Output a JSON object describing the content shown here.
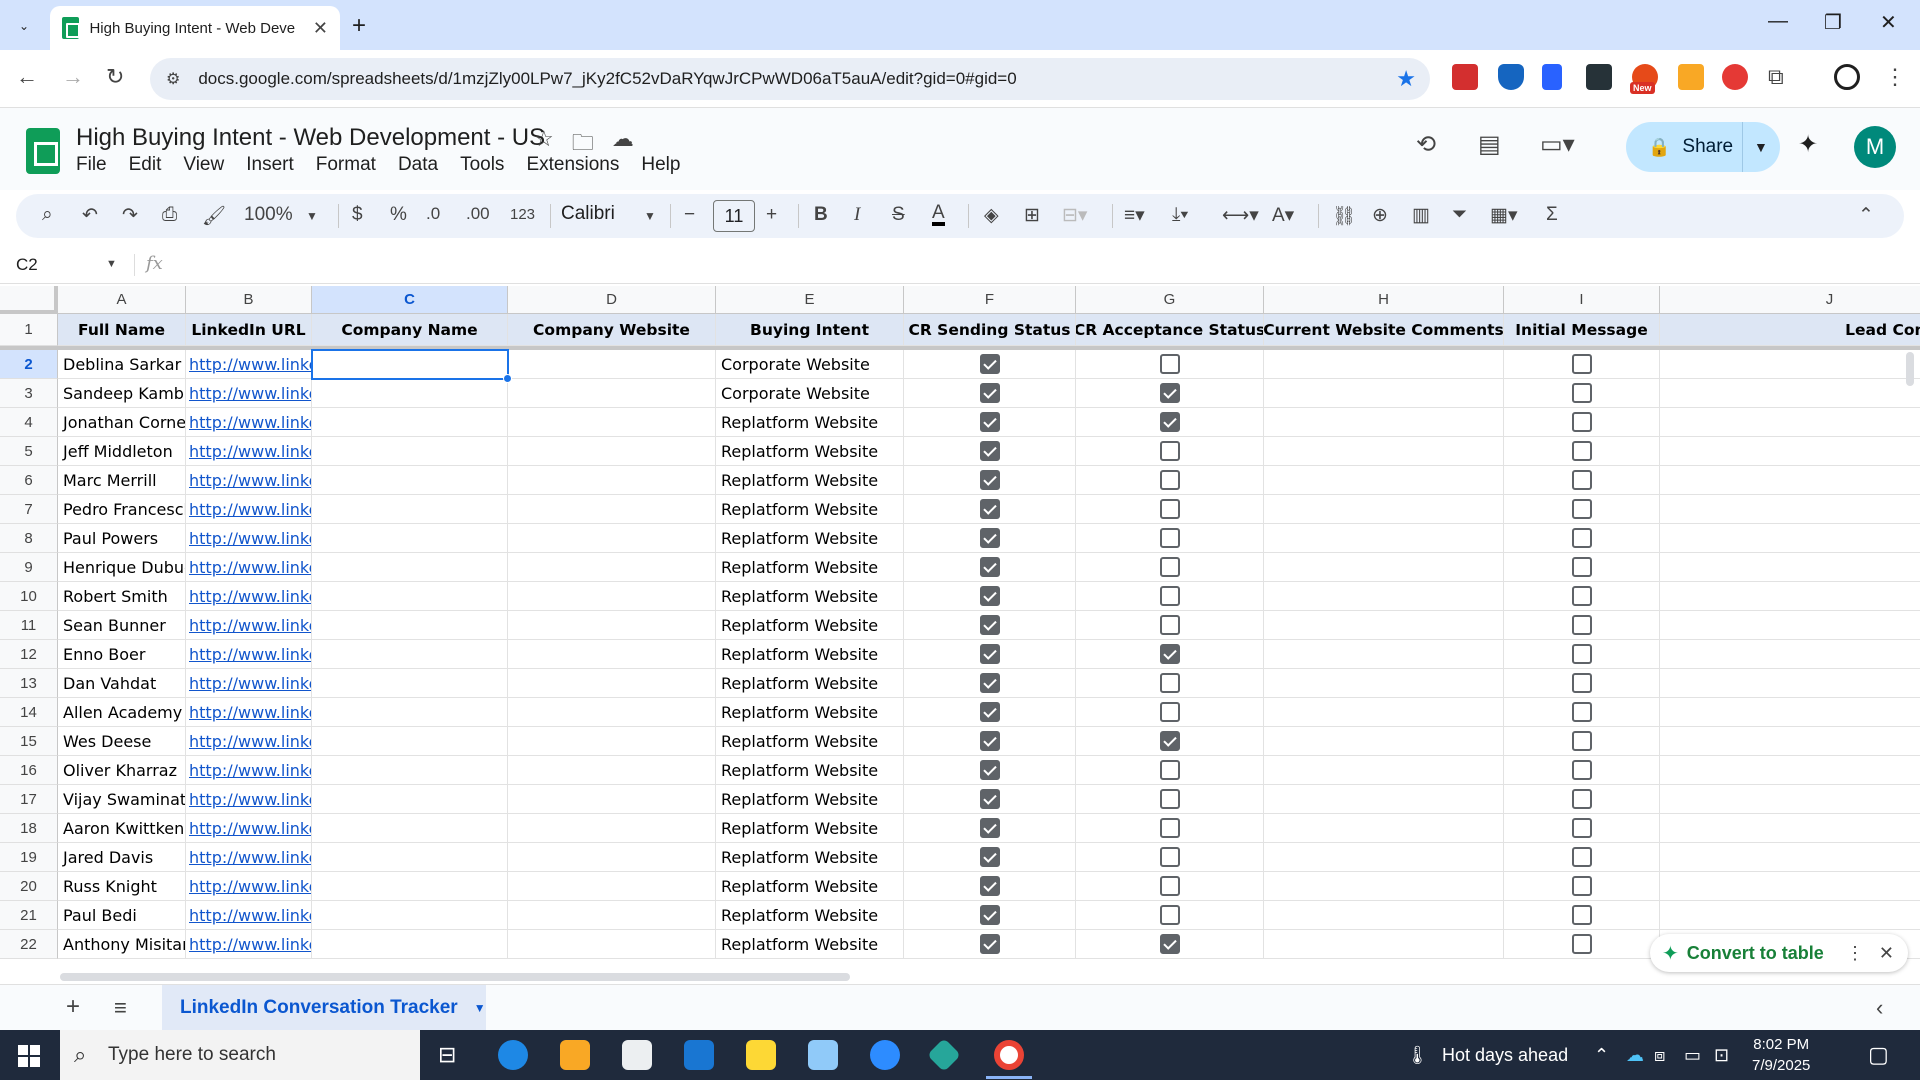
{
  "browser": {
    "tab_title": "High Buying Intent - Web Deve",
    "url": "docs.google.com/spreadsheets/d/1mzjZly00LPw7_jKy2fC52vDaRYqwJrCPwWD06aT5auA/edit?gid=0#gid=0",
    "ext_badge": "New"
  },
  "sheets": {
    "doc_title": "High Buying Intent - Web Development - US",
    "menu": [
      "File",
      "Edit",
      "View",
      "Insert",
      "Format",
      "Data",
      "Tools",
      "Extensions",
      "Help"
    ],
    "share_label": "Share",
    "avatar_letter": "M"
  },
  "toolbar": {
    "zoom": "100%",
    "currency": "$",
    "percent": "%",
    "dec_decrease": ".0",
    "dec_increase": ".00",
    "number_format": "123",
    "font": "Calibri",
    "font_size": "11",
    "bold": "B",
    "italic": "I"
  },
  "formula": {
    "name_box": "C2",
    "fx": "fx"
  },
  "grid": {
    "columns": [
      "A",
      "B",
      "C",
      "D",
      "E",
      "F",
      "G",
      "H",
      "I",
      "J"
    ],
    "selected_column": "C",
    "headers": [
      "Full Name",
      "LinkedIn URL",
      "Company Name",
      "Company Website",
      "Buying Intent",
      "CR Sending Status",
      "CR Acceptance Status",
      "Current Website Comments",
      "Initial Message",
      "Lead Comments"
    ],
    "rows": [
      {
        "num": "2",
        "name": "Deblina Sarkar",
        "url": "http://www.linkedin.com/",
        "intent": "Corporate Website",
        "sent": true,
        "accepted": false,
        "initial": false
      },
      {
        "num": "3",
        "name": "Sandeep Kamble",
        "url": "http://www.linkedin.com/",
        "intent": "Corporate Website",
        "sent": true,
        "accepted": true,
        "initial": false
      },
      {
        "num": "4",
        "name": "Jonathan Cornel",
        "url": "http://www.linkedin.com/",
        "intent": "Replatform Website",
        "sent": true,
        "accepted": true,
        "initial": false
      },
      {
        "num": "5",
        "name": "Jeff Middleton",
        "url": "http://www.linkedin.com/",
        "intent": "Replatform Website",
        "sent": true,
        "accepted": false,
        "initial": false
      },
      {
        "num": "6",
        "name": "Marc Merrill",
        "url": "http://www.linkedin.com/",
        "intent": "Replatform Website",
        "sent": true,
        "accepted": false,
        "initial": false
      },
      {
        "num": "7",
        "name": "Pedro Francesch",
        "url": "http://www.linkedin.com/",
        "intent": "Replatform Website",
        "sent": true,
        "accepted": false,
        "initial": false
      },
      {
        "num": "8",
        "name": "Paul Powers",
        "url": "http://www.linkedin.com/",
        "intent": "Replatform Website",
        "sent": true,
        "accepted": false,
        "initial": false
      },
      {
        "num": "9",
        "name": "Henrique Dubug",
        "url": "http://www.linkedin.com/",
        "intent": "Replatform Website",
        "sent": true,
        "accepted": false,
        "initial": false
      },
      {
        "num": "10",
        "name": "Robert Smith",
        "url": "http://www.linkedin.com/",
        "intent": "Replatform Website",
        "sent": true,
        "accepted": false,
        "initial": false
      },
      {
        "num": "11",
        "name": "Sean Bunner",
        "url": "http://www.linkedin.com/",
        "intent": "Replatform Website",
        "sent": true,
        "accepted": false,
        "initial": false
      },
      {
        "num": "12",
        "name": "Enno Boer",
        "url": "http://www.linkedin.com/",
        "intent": "Replatform Website",
        "sent": true,
        "accepted": true,
        "initial": false
      },
      {
        "num": "13",
        "name": "Dan Vahdat",
        "url": "http://www.linkedin.com/",
        "intent": "Replatform Website",
        "sent": true,
        "accepted": false,
        "initial": false
      },
      {
        "num": "14",
        "name": "Allen Academy",
        "url": "http://www.linkedin.com/",
        "intent": "Replatform Website",
        "sent": true,
        "accepted": false,
        "initial": false
      },
      {
        "num": "15",
        "name": "Wes Deese",
        "url": "http://www.linkedin.com/",
        "intent": "Replatform Website",
        "sent": true,
        "accepted": true,
        "initial": false
      },
      {
        "num": "16",
        "name": "Oliver Kharraz",
        "url": "http://www.linkedin.com/",
        "intent": "Replatform Website",
        "sent": true,
        "accepted": false,
        "initial": false
      },
      {
        "num": "17",
        "name": "Vijay Swaminath",
        "url": "http://www.linkedin.com/",
        "intent": "Replatform Website",
        "sent": true,
        "accepted": false,
        "initial": false
      },
      {
        "num": "18",
        "name": "Aaron Kwittken",
        "url": "http://www.linkedin.com/",
        "intent": "Replatform Website",
        "sent": true,
        "accepted": false,
        "initial": false
      },
      {
        "num": "19",
        "name": "Jared Davis",
        "url": "http://www.linkedin.com/",
        "intent": "Replatform Website",
        "sent": true,
        "accepted": false,
        "initial": false
      },
      {
        "num": "20",
        "name": "Russ Knight",
        "url": "http://www.linkedin.com/",
        "intent": "Replatform Website",
        "sent": true,
        "accepted": false,
        "initial": false
      },
      {
        "num": "21",
        "name": "Paul Bedi",
        "url": "http://www.linkedin.com/",
        "intent": "Replatform Website",
        "sent": true,
        "accepted": false,
        "initial": false
      },
      {
        "num": "22",
        "name": "Anthony Misitan",
        "url": "http://www.linkedin.com/",
        "intent": "Replatform Website",
        "sent": true,
        "accepted": true,
        "initial": false
      }
    ]
  },
  "convert_popup": {
    "label": "Convert to table"
  },
  "sheet_tabs": {
    "active": "LinkedIn Conversation Tracker"
  },
  "taskbar": {
    "search_placeholder": "Type here to search",
    "weather": "Hot days ahead",
    "time": "8:02 PM",
    "date": "7/9/2025"
  },
  "colors": {
    "accent": "#1a73e8",
    "sheets_green": "#0f9d58",
    "share_bg": "#c2e7ff"
  }
}
